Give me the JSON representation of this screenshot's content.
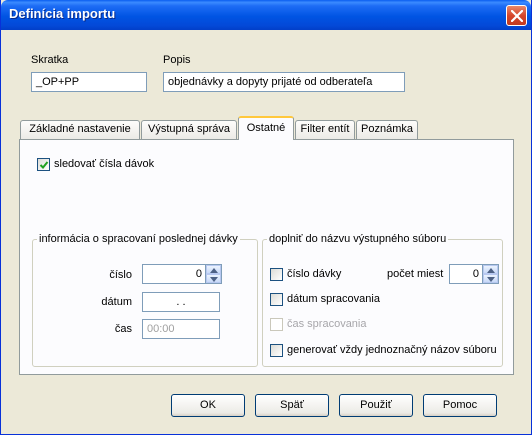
{
  "window": {
    "title": "Definícia importu"
  },
  "fields": {
    "skratka_label": "Skratka",
    "skratka_value": "_OP+PP",
    "popis_label": "Popis",
    "popis_value": "objednávky a dopyty prijaté od odberateľa"
  },
  "tabs": [
    {
      "label": "Základné nastavenie",
      "active": false
    },
    {
      "label": "Výstupná správa",
      "active": false
    },
    {
      "label": "Ostatné",
      "active": true
    },
    {
      "label": "Filter entít",
      "active": false
    },
    {
      "label": "Poznámka",
      "active": false
    }
  ],
  "ostatne": {
    "sledovat_label": "sledovať čísla dávok",
    "sledovat_checked": true,
    "info_group": {
      "title": "informácia o spracovaní poslednej dávky",
      "cislo_label": "číslo",
      "cislo_value": "0",
      "datum_label": "dátum",
      "datum_value": " .  .",
      "cas_label": "čas",
      "cas_value": "00:00"
    },
    "doplnit_group": {
      "title": "doplniť do názvu výstupného súboru",
      "cislo_davky_label": "číslo dávky",
      "cislo_davky_checked": false,
      "pocet_miest_label": "počet miest",
      "pocet_miest_value": "0",
      "datum_spracovania_label": "dátum spracovania",
      "datum_spracovania_checked": false,
      "cas_spracovania_label": "čas spracovania",
      "cas_spracovania_checked": false,
      "generovat_label": "generovať vždy jednoznačný názov súboru",
      "generovat_checked": false
    }
  },
  "buttons": {
    "ok": "OK",
    "spat": "Späť",
    "pouzit": "Použiť",
    "pomoc": "Pomoc"
  },
  "colors": {
    "titlebar": "#0054e3",
    "window_bg": "#ece9d8",
    "tab_highlight": "#ffc83c",
    "close": "#d6462b"
  }
}
